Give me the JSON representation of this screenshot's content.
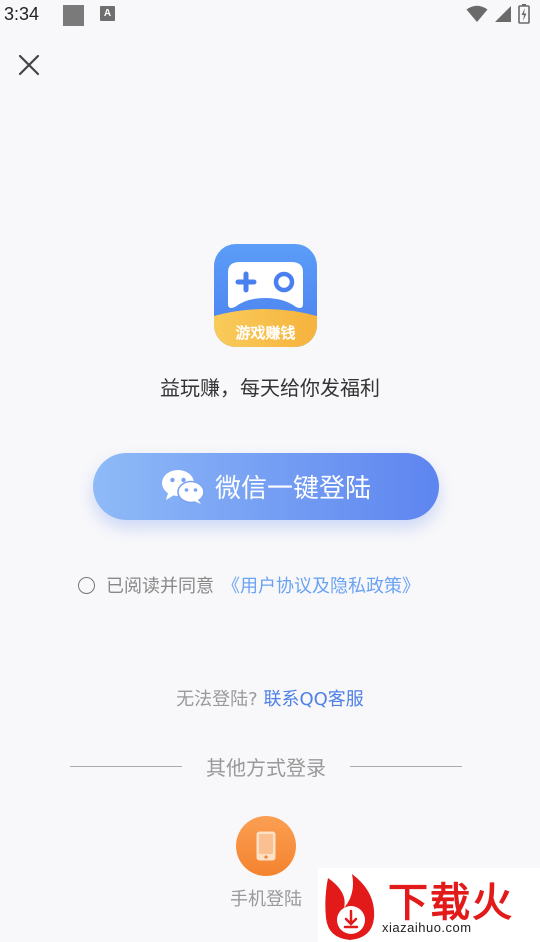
{
  "status_bar": {
    "time": "3:34",
    "notif_letter": "A"
  },
  "app": {
    "logo_text": "游戏赚钱",
    "tagline": "益玩赚，每天给你发福利"
  },
  "wechat_login": {
    "label": "微信一键登陆"
  },
  "agreement": {
    "text": "已阅读并同意",
    "link": "《用户协议及隐私政策》"
  },
  "help": {
    "text": "无法登陆?",
    "link": "联系QQ客服"
  },
  "other_login": {
    "title": "其他方式登录",
    "phone_label": "手机登陆"
  },
  "watermark": {
    "title": "下载火",
    "url": "xiazaihuo.com"
  },
  "colors": {
    "primary": "#5d85f0",
    "link": "#4f7fe7",
    "orange": "#f4832f",
    "watermark_red": "#e21a1a"
  }
}
